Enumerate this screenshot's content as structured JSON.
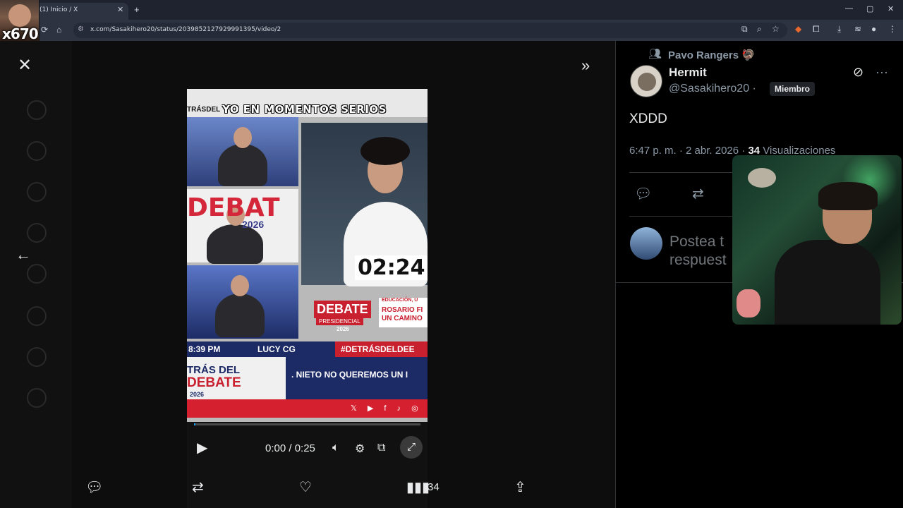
{
  "browser": {
    "tab_title": "(1) Inicio / X",
    "tab_close": "✕",
    "new_tab": "+",
    "url": "x.com/Sasakihero20/status/2039852127929991395/video/2",
    "window_min": "—",
    "window_max": "▢",
    "window_close": "✕"
  },
  "webcam_label": "x670",
  "video": {
    "caption": "YO EN MOMENTOS SERIOS",
    "strip_top": "TRÁS DEL",
    "debat_text": "DEBAT",
    "debat_year": "2026",
    "timer": "02:24",
    "debate_logo": "DEBATE",
    "debate_sub": "PRESIDENCIAL",
    "debate_year": "2026",
    "rosario_l1": "EDUCACIÓN, U",
    "rosario_l2": "ROSARIO FI",
    "rosario_l3": "UN CAMINO",
    "ticker_time": "8:39 PM",
    "ticker_name": "LUCY CG",
    "ticker_tag": "#DETRÁSDELDEE",
    "lower_l1": "TRÁS DEL",
    "lower_l2": "DEBATE",
    "lower_l3": "2026",
    "lower_news": ". NIETO NO QUEREMOS UN I",
    "social": "𝕏 ▶ f ♪ ◎",
    "time_display": "0:00 / 0:25",
    "progress": 0.0
  },
  "actions": {
    "views_count": "34"
  },
  "tweet": {
    "repost_label": "Pavo Rangers 🦃",
    "user_name": "Hermit",
    "user_handle": "@Sasakihero20 ·",
    "member_badge": "Miembro",
    "text": "XDDD",
    "meta_time": "6:47 p. m. · 2 abr. 2026 · ",
    "meta_views_count": "34",
    "meta_views_label": " Visualizaciones",
    "reply_placeholder_l1": "Postea t",
    "reply_placeholder_l2": "respuest"
  },
  "colors": {
    "accent": "#1d9bf0",
    "debate_red": "#c8202f",
    "debate_blue": "#1c2a66"
  },
  "icons": [
    "close-icon",
    "back-arrow-icon",
    "expand-icon",
    "play-icon",
    "volume-icon",
    "settings-icon",
    "pip-icon",
    "fullscreen-icon",
    "reply-icon",
    "repost-icon",
    "like-icon",
    "views-icon",
    "share-icon",
    "grok-icon",
    "more-icon"
  ]
}
